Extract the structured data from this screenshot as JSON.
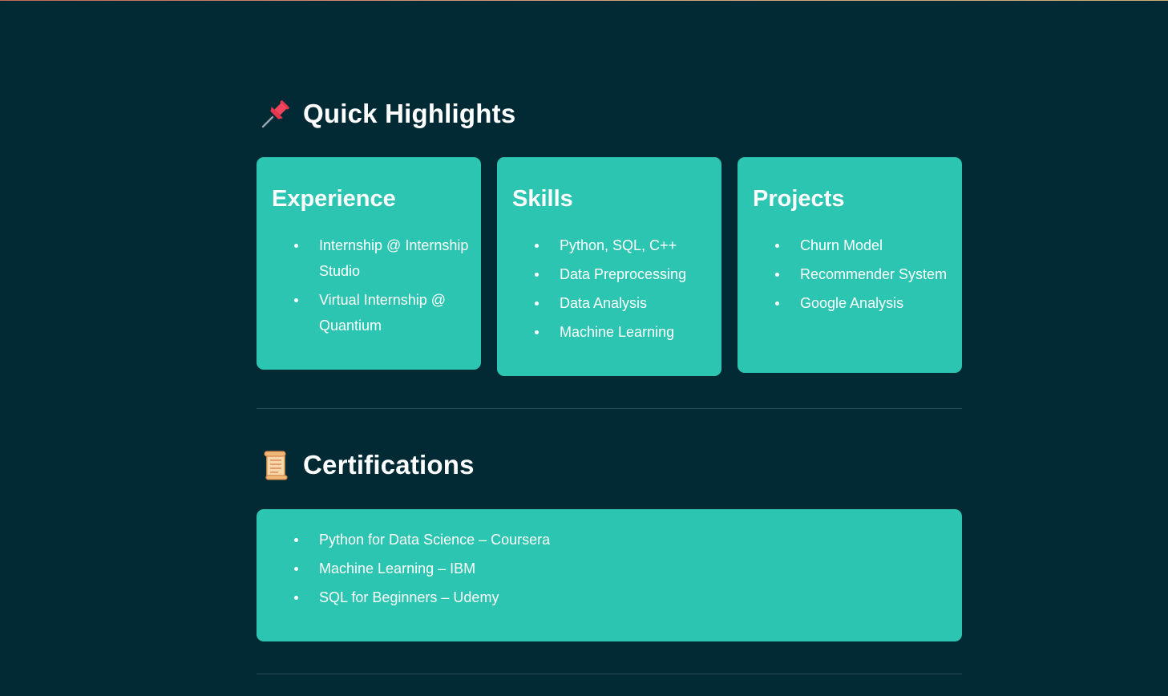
{
  "highlights": {
    "title": "Quick Highlights",
    "icon": "pushpin-icon",
    "cards": [
      {
        "title": "Experience",
        "items": [
          "Internship @ Internship Studio",
          "Virtual Internship @ Quantium"
        ]
      },
      {
        "title": "Skills",
        "items": [
          "Python, SQL, C++",
          "Data Preprocessing",
          "Data Analysis",
          "Machine Learning"
        ]
      },
      {
        "title": "Projects",
        "items": [
          "Churn Model",
          "Recommender System",
          "Google Analysis"
        ]
      }
    ]
  },
  "certifications": {
    "title": "Certifications",
    "icon": "scroll-icon",
    "items": [
      "Python for Data Science – Coursera",
      "Machine Learning – IBM",
      "SQL for Beginners – Udemy"
    ]
  },
  "colors": {
    "background": "#012a35",
    "card": "#2bc5b1",
    "text": "#ffffff"
  }
}
